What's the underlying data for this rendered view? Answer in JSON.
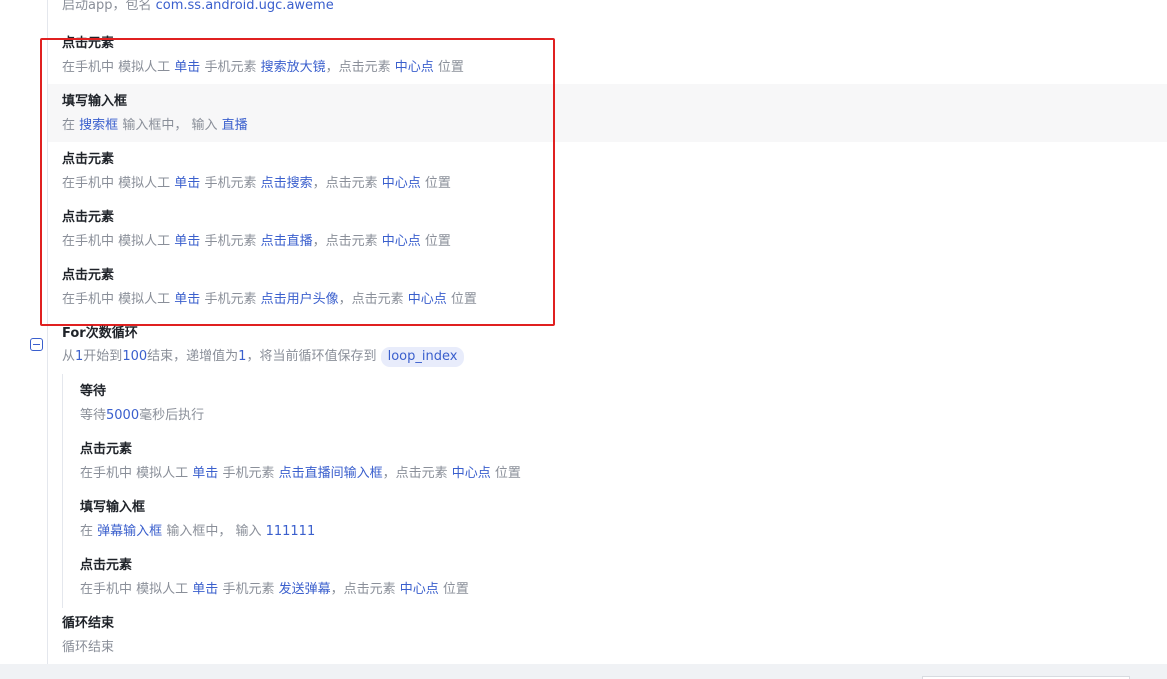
{
  "app_start": {
    "text": "启动app，包名",
    "package": "com.ss.android.ugc.aweme"
  },
  "steps": [
    {
      "title": "点击元素",
      "desc_prefix": "在手机中 模拟人工",
      "action": "单击",
      "mid": "手机元素",
      "element": "搜索放大镜",
      "suffix1": "，点击元素",
      "pos": "中心点",
      "suffix2": "位置"
    },
    {
      "title": "填写输入框",
      "prefix": "在",
      "field": "搜索框",
      "mid": "输入框中，  输入",
      "value": "直播"
    },
    {
      "title": "点击元素",
      "desc_prefix": "在手机中 模拟人工",
      "action": "单击",
      "mid": "手机元素",
      "element": "点击搜索",
      "suffix1": "，点击元素",
      "pos": "中心点",
      "suffix2": "位置"
    },
    {
      "title": "点击元素",
      "desc_prefix": "在手机中 模拟人工",
      "action": "单击",
      "mid": "手机元素",
      "element": "点击直播",
      "suffix1": "，点击元素",
      "pos": "中心点",
      "suffix2": "位置"
    },
    {
      "title": "点击元素",
      "desc_prefix": "在手机中 模拟人工",
      "action": "单击",
      "mid": "手机元素",
      "element": "点击用户头像",
      "suffix1": "，点击元素",
      "pos": "中心点",
      "suffix2": "位置"
    }
  ],
  "loop": {
    "title": "For次数循环",
    "from_text": "从",
    "start": "1",
    "start_text": "开始到",
    "end": "100",
    "end_text": "结束，递增值为",
    "step": "1",
    "save_text": "，将当前循环值保存到",
    "variable": "loop_index"
  },
  "nested": [
    {
      "title": "等待",
      "prefix": "等待",
      "value": "5000",
      "suffix": "毫秒后执行"
    },
    {
      "title": "点击元素",
      "desc_prefix": "在手机中 模拟人工",
      "action": "单击",
      "mid": "手机元素",
      "element": "点击直播间输入框",
      "suffix1": "，点击元素",
      "pos": "中心点",
      "suffix2": "位置"
    },
    {
      "title": "填写输入框",
      "prefix": "在",
      "field": "弹幕输入框",
      "mid": "输入框中，  输入",
      "value": "111111"
    },
    {
      "title": "点击元素",
      "desc_prefix": "在手机中 模拟人工",
      "action": "单击",
      "mid": "手机元素",
      "element": "发送弹幕",
      "suffix1": "，点击元素",
      "pos": "中心点",
      "suffix2": "位置"
    }
  ],
  "loop_end": {
    "title": "循环结束",
    "desc": "循环结束"
  },
  "colors": {
    "highlight": "#3a5fcd",
    "annotation_box": "#e02020"
  }
}
